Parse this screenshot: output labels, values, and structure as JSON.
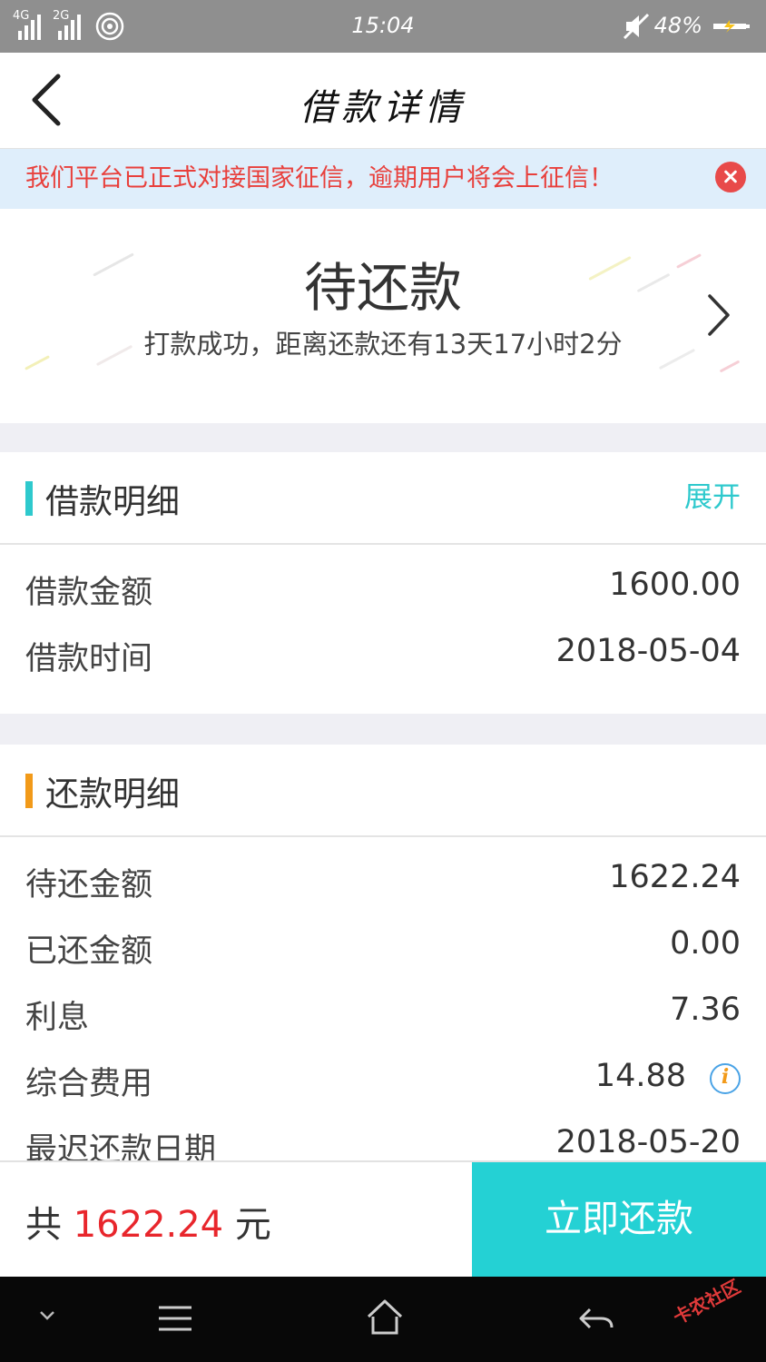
{
  "status_bar": {
    "network1": "4G",
    "network2": "2G",
    "time": "15:04",
    "battery": "48%"
  },
  "header": {
    "title": "借款详情"
  },
  "notice": {
    "text": "我们平台已正式对接国家征信，逾期用户将会上征信！"
  },
  "status_card": {
    "status": "待还款",
    "detail": "打款成功，距离还款还有13天17小时2分"
  },
  "loan_section": {
    "title": "借款明细",
    "expand_label": "展开",
    "accent": "#2ec9cd",
    "rows": [
      {
        "label": "借款金额",
        "value": "1600.00"
      },
      {
        "label": "借款时间",
        "value": "2018-05-04"
      }
    ]
  },
  "repay_section": {
    "title": "还款明细",
    "accent": "#f29a19",
    "rows": [
      {
        "label": "待还金额",
        "value": "1622.24"
      },
      {
        "label": "已还金额",
        "value": "0.00"
      },
      {
        "label": "利息",
        "value": "7.36"
      },
      {
        "label": "综合费用",
        "value": "14.88"
      },
      {
        "label": "最迟还款日期",
        "value": "2018-05-20"
      }
    ]
  },
  "paybar": {
    "prefix": "共",
    "amount": "1622.24",
    "suffix": "元",
    "button_label": "立即还款",
    "button_color": "#24d1d4"
  },
  "nav": {
    "icons": [
      "chevron-down-icon",
      "menu-icon",
      "home-icon",
      "back-icon"
    ]
  },
  "watermark": "卡农社区"
}
